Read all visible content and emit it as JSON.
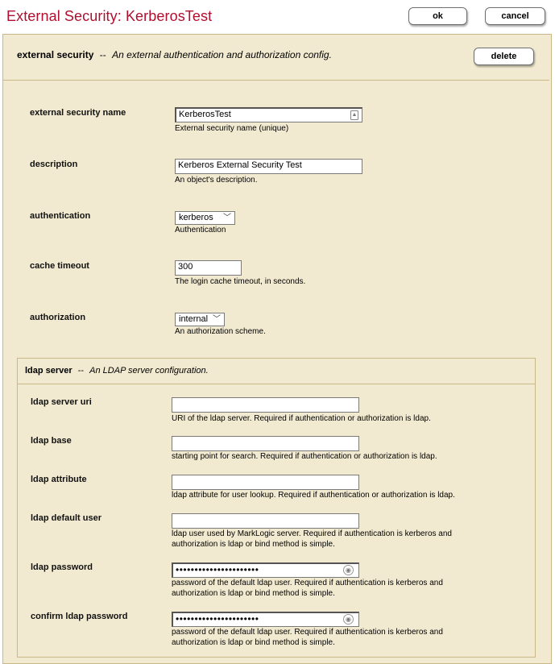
{
  "page": {
    "title": "External Security: KerberosTest",
    "ok_label": "ok",
    "cancel_label": "cancel"
  },
  "section": {
    "title": "external security",
    "separator": "--",
    "description": "An external authentication and authorization config.",
    "delete_label": "delete"
  },
  "fields": {
    "name": {
      "label": "external security name",
      "value": "KerberosTest",
      "help": "External security name (unique)"
    },
    "description": {
      "label": "description",
      "value": "Kerberos External Security Test",
      "help": "An object's description."
    },
    "authentication": {
      "label": "authentication",
      "value": "kerberos",
      "help": "Authentication"
    },
    "cache_timeout": {
      "label": "cache timeout",
      "value": "300",
      "help": "The login cache timeout, in seconds."
    },
    "authorization": {
      "label": "authorization",
      "value": "internal",
      "help": "An authorization scheme."
    }
  },
  "ldap": {
    "title": "ldap server",
    "separator": "--",
    "description": "An LDAP server configuration.",
    "server_uri": {
      "label": "ldap server uri",
      "value": "",
      "help": "URI of the ldap server. Required if authentication or authorization is ldap."
    },
    "base": {
      "label": "ldap base",
      "value": "",
      "help": "starting point for search. Required if authentication or authorization is ldap."
    },
    "attribute": {
      "label": "ldap attribute",
      "value": "",
      "help": "ldap attribute for user lookup. Required if authentication or authorization is ldap."
    },
    "default_user": {
      "label": "ldap default user",
      "value": "",
      "help_line1": "ldap user used by MarkLogic server. Required if authentication is kerberos and",
      "help_line2": "authorization is ldap or bind method is simple."
    },
    "password": {
      "label": "ldap password",
      "masked_value": "••••••••••••••••••••••",
      "help_line1": "password of the default ldap user. Required if authentication is kerberos and",
      "help_line2": "authorization is ldap or bind method is simple."
    },
    "confirm_password": {
      "label": "confirm ldap password",
      "masked_value": "••••••••••••••••••••••",
      "help_line1": "password of the default ldap user. Required if authentication is kerberos and",
      "help_line2": "authorization is ldap or bind method is simple."
    }
  },
  "colors": {
    "title_red": "#b01030",
    "panel_bg": "#f2ead0",
    "panel_border": "#c9b98a"
  },
  "icons": {
    "name_field_icon": "contact-card-icon",
    "password_field_icon": "key-reveal-icon"
  }
}
